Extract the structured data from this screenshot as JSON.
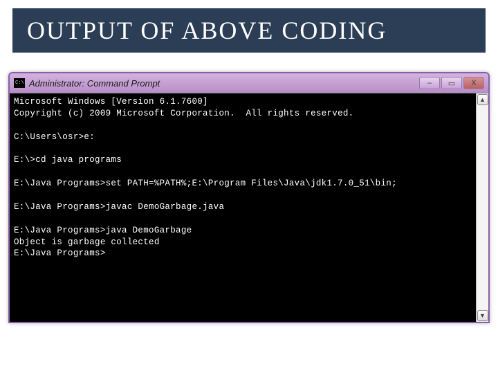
{
  "slide": {
    "title": "OUTPUT OF ABOVE CODING"
  },
  "window": {
    "title": "Administrator: Command Prompt",
    "controls": {
      "minimize": "–",
      "maximize": "▭",
      "close": "X"
    }
  },
  "console": {
    "lines": [
      "Microsoft Windows [Version 6.1.7600]",
      "Copyright (c) 2009 Microsoft Corporation.  All rights reserved.",
      "",
      "C:\\Users\\osr>e:",
      "",
      "E:\\>cd java programs",
      "",
      "E:\\Java Programs>set PATH=%PATH%;E:\\Program Files\\Java\\jdk1.7.0_51\\bin;",
      "",
      "E:\\Java Programs>javac DemoGarbage.java",
      "",
      "E:\\Java Programs>java DemoGarbage",
      "Object is garbage collected",
      "E:\\Java Programs>"
    ]
  },
  "scrollbar": {
    "up": "▲",
    "down": "▼"
  }
}
